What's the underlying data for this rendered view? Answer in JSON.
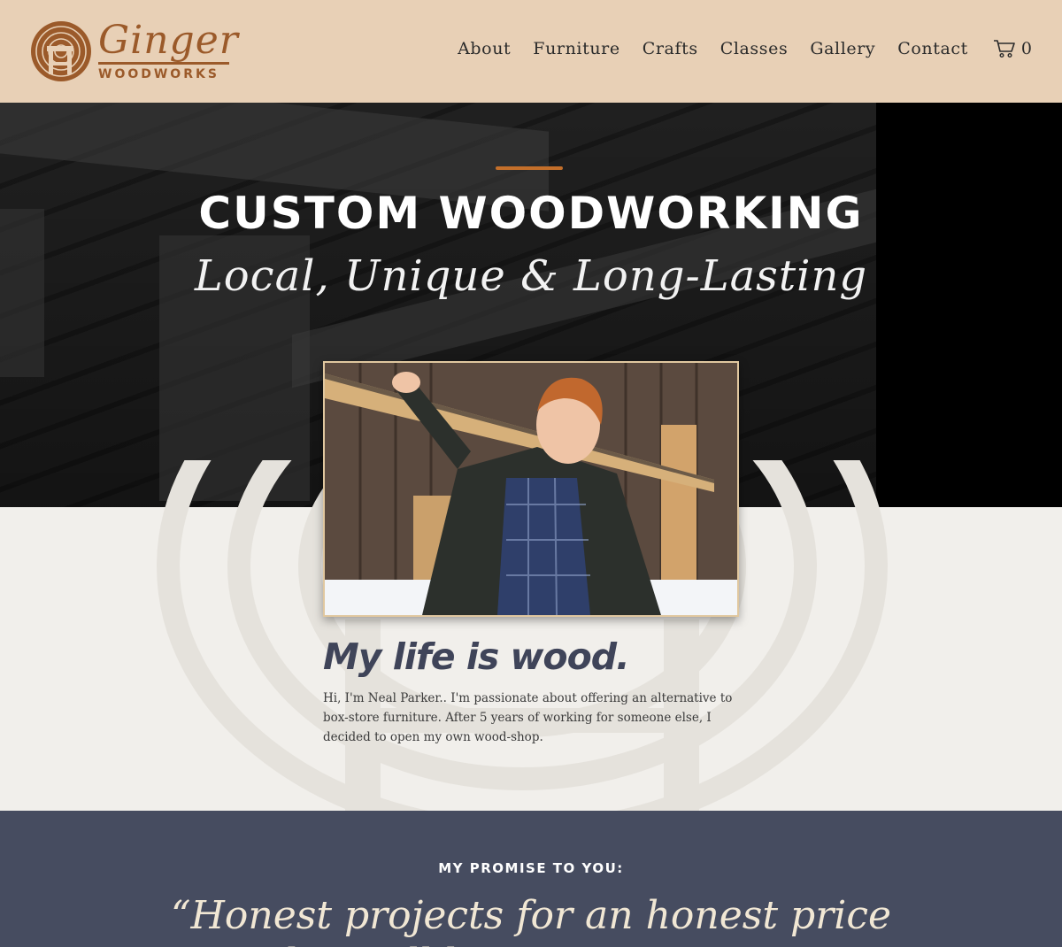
{
  "brand": {
    "name": "Ginger",
    "sub": "WOODWORKS",
    "accent": "#9b5a2a"
  },
  "nav": {
    "items": [
      "About",
      "Furniture",
      "Crafts",
      "Classes",
      "Gallery",
      "Contact"
    ],
    "cart_count": "0"
  },
  "hero": {
    "title": "CUSTOM WOODWORKING",
    "subtitle": "Local, Unique & Long-Lasting",
    "accent_color": "#c46f2a"
  },
  "intro": {
    "title": "My life is wood.",
    "body": "Hi, I'm Neal Parker.. I'm passionate about offering an alternative to box-store furniture. After 5 years of working for someone else, I decided to open my own wood-shop."
  },
  "promise": {
    "label": "MY PROMISE TO YOU:",
    "quote_line1": "“Honest projects for an honest price",
    "quote_line2": "that will last generations.”",
    "band_color": "#464c60"
  }
}
